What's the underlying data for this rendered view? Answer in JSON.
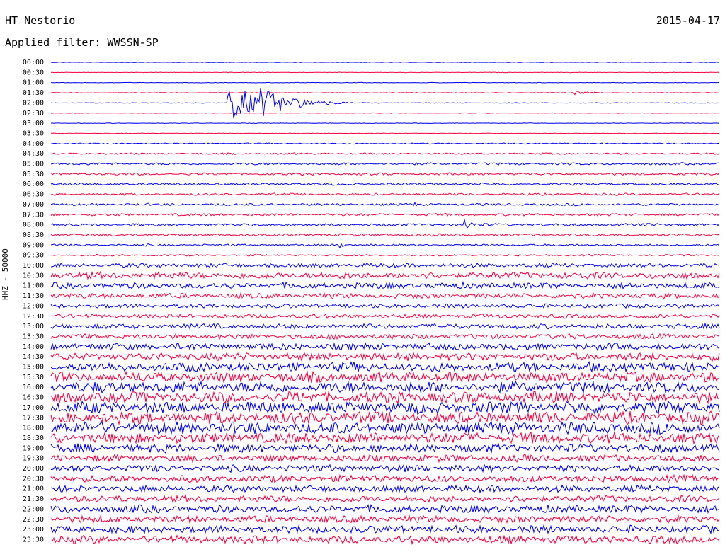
{
  "header": {
    "station": "HT Nestorio",
    "date": "2015-04-17",
    "filter": "Applied filter: WWSSN-SP"
  },
  "channel_label": "HHZ - 50000",
  "colors": {
    "odd_trace": "#0000ff",
    "even_trace": "#ff0040",
    "background": "#ffffff"
  },
  "chart_data": {
    "type": "helicorder",
    "row_labels": [
      "00:00",
      "00:30",
      "01:00",
      "01:30",
      "02:00",
      "02:30",
      "03:00",
      "03:30",
      "04:00",
      "04:30",
      "05:00",
      "05:30",
      "06:00",
      "06:30",
      "07:00",
      "07:30",
      "08:00",
      "08:30",
      "09:00",
      "09:30",
      "10:00",
      "10:30",
      "11:00",
      "11:30",
      "12:00",
      "12:30",
      "13:00",
      "13:30",
      "14:00",
      "14:30",
      "15:00",
      "15:30",
      "16:00",
      "16:30",
      "17:00",
      "17:30",
      "18:00",
      "18:30",
      "19:00",
      "19:30",
      "20:00",
      "20:30",
      "21:00",
      "21:30",
      "22:00",
      "22:30",
      "23:00",
      "23:30"
    ],
    "row_amplitude": [
      0.3,
      0.3,
      0.3,
      0.4,
      0.4,
      0.3,
      0.3,
      0.3,
      0.7,
      1.0,
      1.4,
      1.4,
      1.4,
      1.3,
      1.4,
      1.5,
      1.6,
      1.5,
      1.2,
      1.0,
      2.5,
      4.0,
      3.5,
      3.0,
      2.5,
      2.5,
      3.0,
      3.0,
      4.0,
      4.5,
      5.5,
      6.0,
      6.5,
      6.5,
      7.0,
      7.0,
      7.0,
      6.5,
      5.0,
      4.0,
      4.0,
      4.0,
      4.0,
      4.0,
      4.5,
      4.0,
      4.5,
      4.5
    ],
    "events": [
      {
        "row": "02:00",
        "minute": 7.9,
        "amplitude": 28,
        "duration_min": 4.5
      },
      {
        "row": "02:00",
        "minute": 9.4,
        "amplitude": 22,
        "duration_min": 4.0
      },
      {
        "row": "01:30",
        "minute": 23.5,
        "amplitude": 3,
        "duration_min": 2.5
      },
      {
        "row": "07:00",
        "minute": 16.2,
        "amplitude": 6,
        "duration_min": 0.6
      },
      {
        "row": "08:00",
        "minute": 18.5,
        "amplitude": 12,
        "duration_min": 1.0
      },
      {
        "row": "09:00",
        "minute": 12.9,
        "amplitude": 5,
        "duration_min": 1.2
      }
    ]
  }
}
